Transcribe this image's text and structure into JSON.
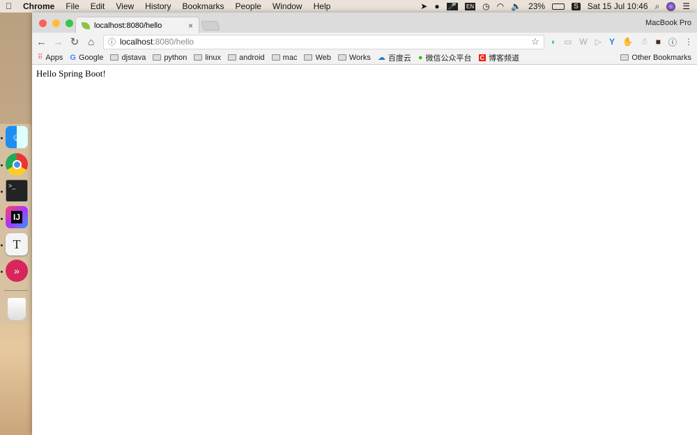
{
  "menubar": {
    "apple": "",
    "app": "Chrome",
    "items": [
      "File",
      "Edit",
      "View",
      "History",
      "Bookmarks",
      "People",
      "Window",
      "Help"
    ],
    "status": {
      "input": "EN",
      "battery": "23%",
      "datetime": "Sat 15 Jul  10:46"
    }
  },
  "browser": {
    "profile": "MacBook Pro",
    "tab": {
      "title": "localhost:8080/hello",
      "close": "×"
    },
    "address": {
      "host": "localhost",
      "rest": ":8080/hello"
    },
    "bookmarks": [
      {
        "label": "Apps",
        "icon": "apps-grid-icon"
      },
      {
        "label": "Google",
        "icon": "google-icon"
      },
      {
        "label": "djstava",
        "icon": "folder-icon"
      },
      {
        "label": "python",
        "icon": "folder-icon"
      },
      {
        "label": "linux",
        "icon": "folder-icon"
      },
      {
        "label": "android",
        "icon": "folder-icon"
      },
      {
        "label": "mac",
        "icon": "folder-icon"
      },
      {
        "label": "Web",
        "icon": "folder-icon"
      },
      {
        "label": "Works",
        "icon": "folder-icon"
      },
      {
        "label": "百度云",
        "icon": "baidu-cloud-icon"
      },
      {
        "label": "微信公众平台",
        "icon": "wechat-icon"
      },
      {
        "label": "博客频道",
        "icon": "csdn-icon"
      }
    ],
    "other_bookmarks": "Other Bookmarks"
  },
  "page": {
    "text": "Hello Spring Boot!"
  },
  "dock": {
    "apps": [
      "finder",
      "chrome",
      "terminal",
      "intellij-idea",
      "typora",
      "skitch",
      "trash"
    ]
  }
}
